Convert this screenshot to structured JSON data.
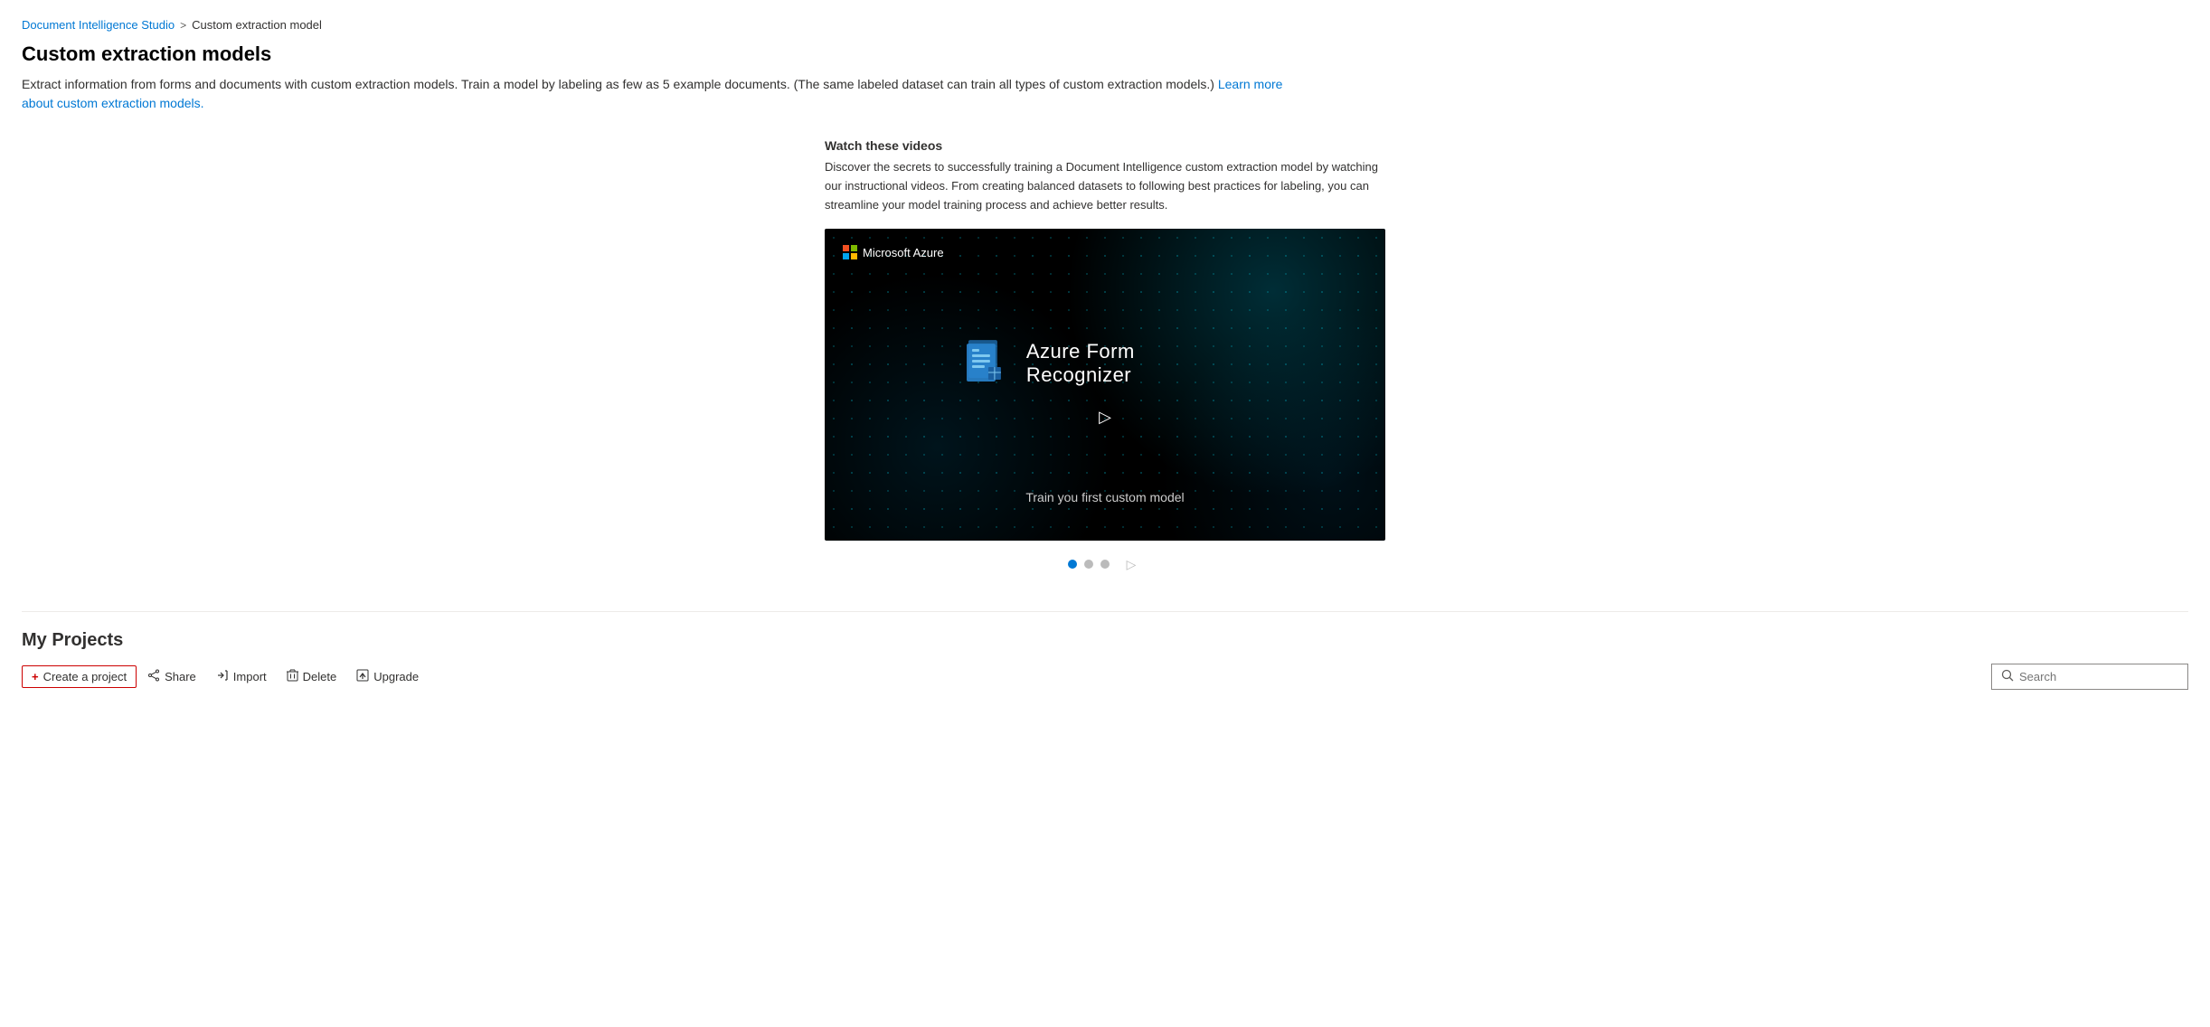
{
  "breadcrumb": {
    "parent_label": "Document Intelligence Studio",
    "separator": ">",
    "current_label": "Custom extraction model"
  },
  "page": {
    "title": "Custom extraction models",
    "description": "Extract information from forms and documents with custom extraction models. Train a model by labeling as few as 5 example documents. (The same labeled dataset can train all types of custom extraction models.)",
    "learn_more_label": "Learn more about custom extraction models."
  },
  "video_section": {
    "info_title": "Watch these videos",
    "info_description": "Discover the secrets to successfully training a Document Intelligence custom extraction model by watching our instructional videos. From creating balanced datasets to following best practices for labeling, you can streamline your model training process and achieve better results.",
    "video_title": "Azure Form Recognizer",
    "video_subtitle": "Train you first custom model",
    "azure_logo_text": "Microsoft Azure",
    "carousel_dots": [
      {
        "active": true
      },
      {
        "active": false
      },
      {
        "active": false
      }
    ],
    "carousel_next_icon": "▷"
  },
  "projects_section": {
    "title": "My Projects",
    "toolbar": {
      "create_label": "Create a project",
      "share_label": "Share",
      "import_label": "Import",
      "delete_label": "Delete",
      "upgrade_label": "Upgrade",
      "search_placeholder": "Search"
    }
  }
}
